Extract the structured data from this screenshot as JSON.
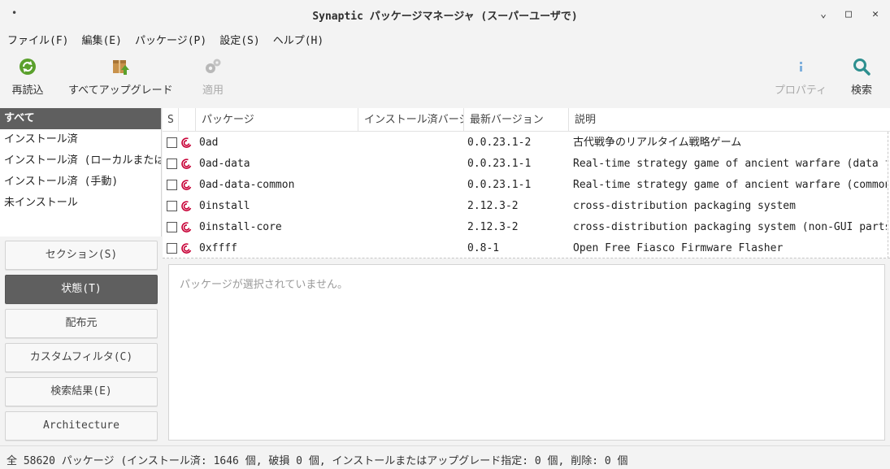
{
  "window": {
    "title": "Synaptic パッケージマネージャ  (スーパーユーザで)",
    "menu_dot": "•",
    "minimize": "⌄",
    "maximize": "□",
    "close": "✕"
  },
  "menu": {
    "items": [
      "ファイル(F)",
      "編集(E)",
      "パッケージ(P)",
      "設定(S)",
      "ヘルプ(H)"
    ]
  },
  "toolbar": {
    "reload_label": "再読込",
    "upgrade_all_label": "すべてアップグレード",
    "apply_label": "適用",
    "properties_label": "プロパティ",
    "search_label": "検索",
    "colors": {
      "green": "#5aa02c",
      "teal": "#2d8f8f",
      "disabled": "#b8b8b8",
      "box": "#c8924b"
    }
  },
  "filters": {
    "items": [
      "すべて",
      "インストール済",
      "インストール済 (ローカルまたは",
      "インストール済 (手動)",
      "未インストール"
    ],
    "selected_index": 0
  },
  "filter_buttons": {
    "section": "セクション(S)",
    "status": "状態(T)",
    "origin": "配布元",
    "custom": "カスタムフィルタ(C)",
    "search_results": "検索結果(E)",
    "architecture": "Architecture",
    "active": "status"
  },
  "table": {
    "headers": {
      "s": "S",
      "package": "パッケージ",
      "installed": "インストール済バージ",
      "latest": "最新バージョン",
      "description": "説明"
    },
    "rows": [
      {
        "name": "0ad",
        "installed": "",
        "latest": "0.0.23.1-2",
        "description": "古代戦争のリアルタイム戦略ゲーム"
      },
      {
        "name": "0ad-data",
        "installed": "",
        "latest": "0.0.23.1-1",
        "description": "Real-time strategy game of ancient warfare (data files)"
      },
      {
        "name": "0ad-data-common",
        "installed": "",
        "latest": "0.0.23.1-1",
        "description": "Real-time strategy game of ancient warfare (common data"
      },
      {
        "name": "0install",
        "installed": "",
        "latest": "2.12.3-2",
        "description": "cross-distribution packaging system"
      },
      {
        "name": "0install-core",
        "installed": "",
        "latest": "2.12.3-2",
        "description": "cross-distribution packaging system (non-GUI parts)"
      },
      {
        "name": "0xffff",
        "installed": "",
        "latest": "0.8-1",
        "description": "Open Free Fiasco Firmware Flasher"
      }
    ],
    "debian_color": "#c70036"
  },
  "details": {
    "message": "パッケージが選択されていません。"
  },
  "status": {
    "text": "全 58620 パッケージ (インストール済: 1646 個, 破損 0 個, インストールまたはアップグレード指定: 0 個, 削除: 0 個"
  }
}
